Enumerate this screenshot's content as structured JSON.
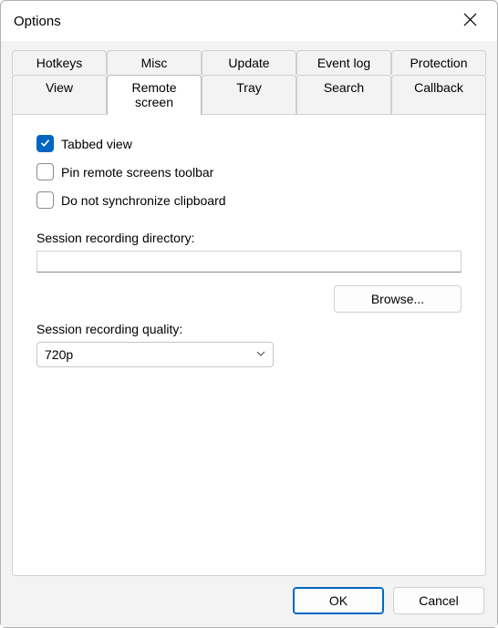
{
  "window": {
    "title": "Options"
  },
  "tabs": {
    "row1": [
      {
        "id": "hotkeys",
        "label": "Hotkeys"
      },
      {
        "id": "misc",
        "label": "Misc"
      },
      {
        "id": "update",
        "label": "Update"
      },
      {
        "id": "event-log",
        "label": "Event log"
      },
      {
        "id": "protection",
        "label": "Protection"
      }
    ],
    "row2": [
      {
        "id": "view",
        "label": "View"
      },
      {
        "id": "remote-screen",
        "label": "Remote screen",
        "active": true
      },
      {
        "id": "tray",
        "label": "Tray"
      },
      {
        "id": "search",
        "label": "Search"
      },
      {
        "id": "callback",
        "label": "Callback"
      }
    ]
  },
  "remoteScreen": {
    "tabbedView": {
      "label": "Tabbed view",
      "checked": true
    },
    "pinToolbar": {
      "label": "Pin remote screens toolbar",
      "checked": false
    },
    "noSyncClipboard": {
      "label": "Do not synchronize clipboard",
      "checked": false
    },
    "recordingDirLabel": "Session recording directory:",
    "recordingDirValue": "",
    "browseLabel": "Browse...",
    "recordingQualityLabel": "Session recording quality:",
    "recordingQualityValue": "720p"
  },
  "buttons": {
    "ok": "OK",
    "cancel": "Cancel"
  }
}
